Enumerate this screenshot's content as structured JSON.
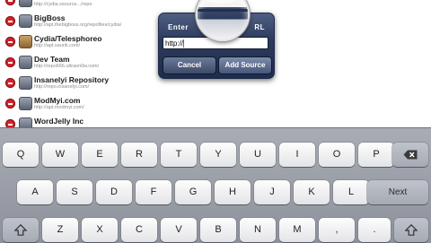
{
  "sources": [
    {
      "name": "",
      "url": "http://cydia.xsource.../repo",
      "icon": "source-icon"
    },
    {
      "name": "BigBoss",
      "url": "http://apt.thebigboss.org/repofiles/cydia/",
      "icon": "source-icon"
    },
    {
      "name": "Cydia/Telesphoreo",
      "url": "http://apt.saurik.com/",
      "icon": "cydia-icon"
    },
    {
      "name": "Dev Team",
      "url": "http://repo666.ultrasn0w.com/",
      "icon": "source-icon"
    },
    {
      "name": "Insanelyi Repository",
      "url": "http://repo.insanelyi.com/",
      "icon": "source-icon"
    },
    {
      "name": "ModMyi.com",
      "url": "http://apt.modmyi.com/",
      "icon": "source-icon"
    },
    {
      "name": "WordJelly Inc",
      "url": "",
      "icon": "source-icon"
    }
  ],
  "dialog": {
    "title_left": "Enter",
    "title_right": "RL",
    "input_value": "http://",
    "cancel_label": "Cancel",
    "add_label": "Add Source"
  },
  "keyboard": {
    "row1": [
      "Q",
      "W",
      "E",
      "R",
      "T",
      "Y",
      "U",
      "I",
      "O",
      "P"
    ],
    "row2": [
      "A",
      "S",
      "D",
      "F",
      "G",
      "H",
      "J",
      "K",
      "L"
    ],
    "row3": [
      "Z",
      "X",
      "C",
      "V",
      "B",
      "N",
      "M",
      ",",
      "."
    ],
    "next_label": "Next",
    "backspace_icon": "backspace-icon",
    "shift_icon": "shift-icon"
  },
  "colors": {
    "delete_badge": "#d2232a",
    "alert_bg": "#2d3c5e",
    "keyboard_bg": "#9a9ea7"
  }
}
